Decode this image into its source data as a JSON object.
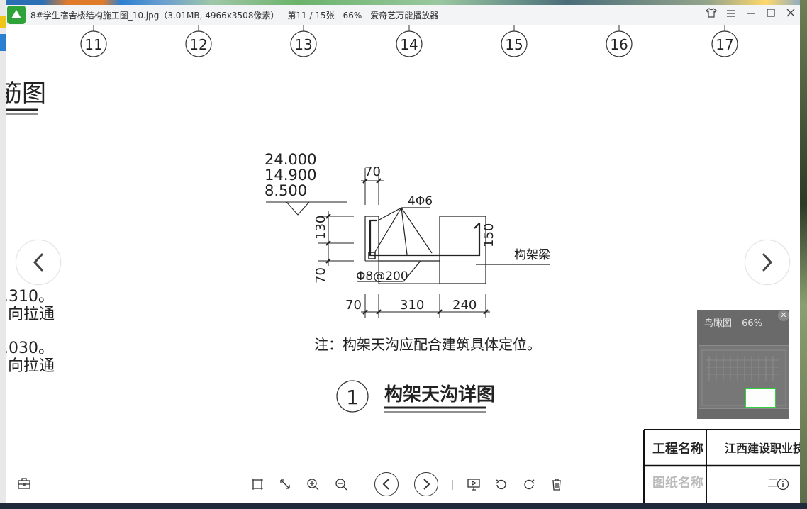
{
  "window": {
    "title": "8#学生宿舍楼结构施工图_10.jpg（3.01MB, 4966x3508像素） - 第11 / 15张 - 66% - 爱奇艺万能播放器"
  },
  "drawing": {
    "axis_labels": [
      "11",
      "12",
      "13",
      "14",
      "15",
      "16",
      "17"
    ],
    "section_title_partial": "筋图",
    "left_notes": [
      ".310。",
      "向拉通",
      ".030。",
      "向拉通"
    ],
    "elevations": [
      "24.000",
      "14.900",
      "8.500"
    ],
    "dims_top": "70",
    "rebar_label": "4Φ6",
    "stirrup_label": "Φ8@200",
    "dim_130": "130",
    "dim_70_left": "70",
    "dim_150": "150",
    "beam_label": "构架梁",
    "dims_bottom": [
      "70",
      "310",
      "240"
    ],
    "note": "注：构架天沟应配合建筑具体定位。",
    "detail_number": "1",
    "detail_title": "构架天沟详图",
    "table": {
      "row1_label": "工程名称",
      "row1_value": "江西建设职业技术",
      "row2_label": "图纸名称",
      "row2_value": "二"
    }
  },
  "birdeye": {
    "title": "鸟瞰图",
    "zoom": "66%"
  },
  "colors": {
    "accent_green": "#2fa33a",
    "selection_green": "#30d040"
  }
}
